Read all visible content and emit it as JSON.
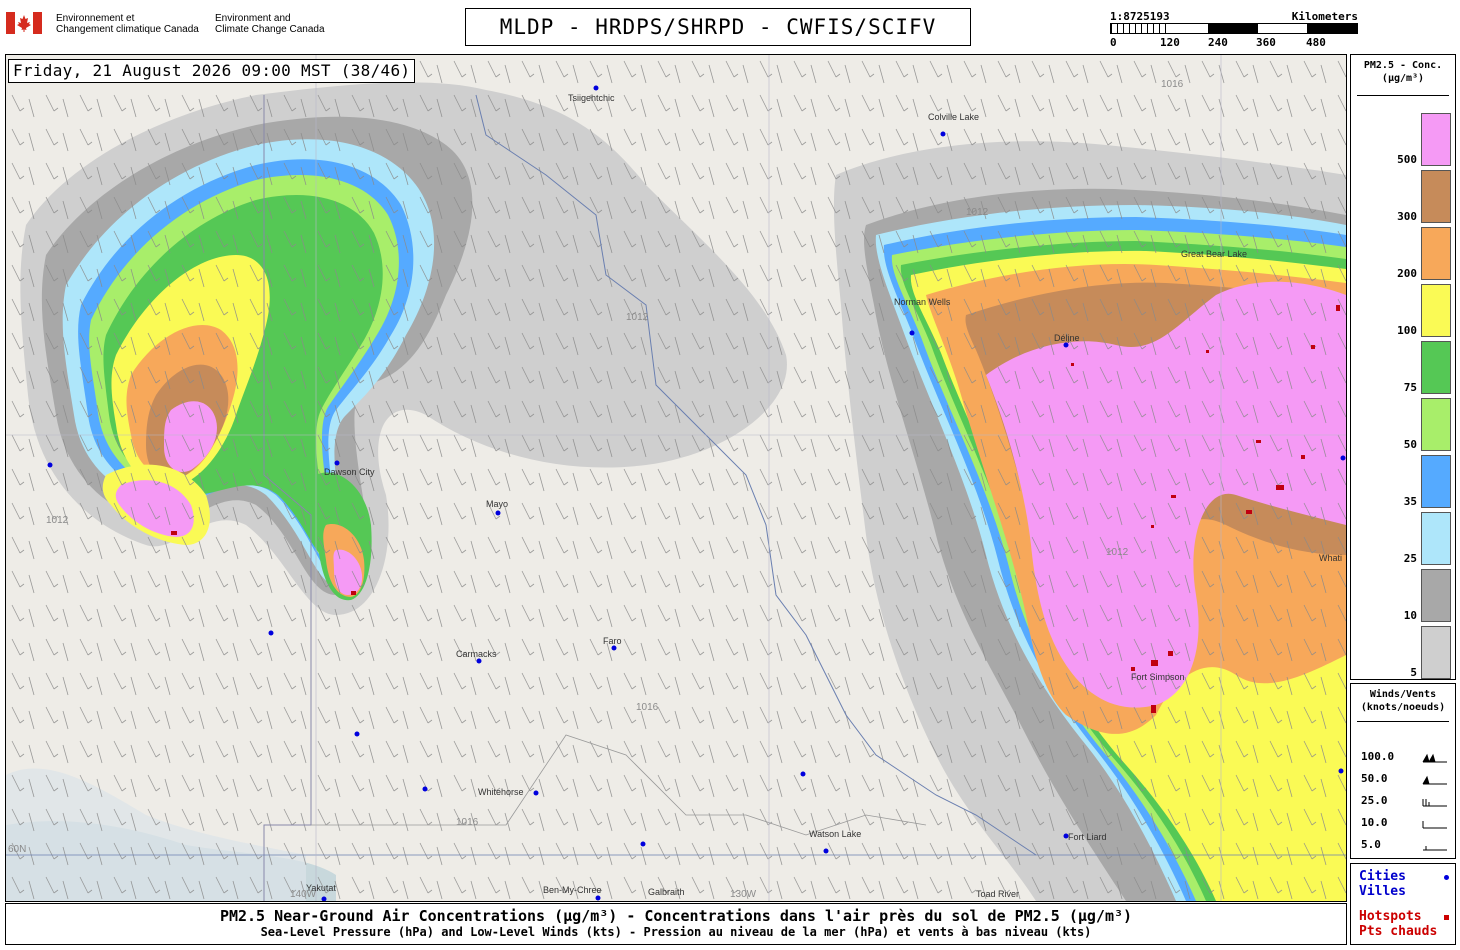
{
  "header": {
    "agency_fr_1": "Environnement et",
    "agency_fr_2": "Changement climatique Canada",
    "agency_en_1": "Environment and",
    "agency_en_2": "Climate Change Canada",
    "title": "MLDP - HRDPS/SHRPD - CWFIS/SCIFV"
  },
  "scale": {
    "ratio": "1:8725193",
    "units": "Kilometers",
    "ticks": [
      "0",
      "120",
      "240",
      "360",
      "480"
    ]
  },
  "map": {
    "timestamp": "Friday, 21 August 2026 09:00 MST (38/46)",
    "cities": [
      {
        "name": "Tsiigehtchic",
        "show_label": true
      },
      {
        "name": "Colville Lake",
        "show_label": true
      },
      {
        "name": "Norman Wells",
        "show_label": true
      },
      {
        "name": "Délįne",
        "show_label": true
      },
      {
        "name": "Great Bear Lake",
        "show_label": true
      },
      {
        "name": "Dawson City",
        "show_label": true
      },
      {
        "name": "Mayo",
        "show_label": true
      },
      {
        "name": "Carmacks",
        "show_label": true
      },
      {
        "name": "Faro",
        "show_label": true
      },
      {
        "name": "Whitehorse",
        "show_label": true
      },
      {
        "name": "Watson Lake",
        "show_label": true
      },
      {
        "name": "Fort Liard",
        "show_label": true
      },
      {
        "name": "Fort Simpson",
        "show_label": true
      },
      {
        "name": "Whati",
        "show_label": true
      },
      {
        "name": "Yakutat",
        "show_label": true
      },
      {
        "name": "Ben-My-Chree",
        "show_label": true
      },
      {
        "name": "Galbraith",
        "show_label": true
      },
      {
        "name": "Toad River",
        "show_label": true
      }
    ],
    "isobar_labels": [
      "1012",
      "1016"
    ],
    "graticule_labels": [
      "60N",
      "140W",
      "130W"
    ],
    "hotspot_color": "#c00010",
    "city_color": "#0000dd"
  },
  "legend": {
    "title_1": "PM2.5 - Conc.",
    "title_2": "(µg/m³)",
    "levels": [
      {
        "label": "500",
        "color": "#f59af5"
      },
      {
        "label": "300",
        "color": "#c68b5a"
      },
      {
        "label": "200",
        "color": "#f7a85a"
      },
      {
        "label": "100",
        "color": "#fafa55"
      },
      {
        "label": "75",
        "color": "#55c855"
      },
      {
        "label": "50",
        "color": "#a8ee6a"
      },
      {
        "label": "35",
        "color": "#55aaff"
      },
      {
        "label": "25",
        "color": "#aee6fa"
      },
      {
        "label": "10",
        "color": "#a8a8a8"
      },
      {
        "label": "5",
        "color": "#cfcfcf"
      }
    ]
  },
  "winds": {
    "title_1": "Winds/Vents",
    "title_2": "(knots/noeuds)",
    "speeds": [
      "100.0",
      "50.0",
      "25.0",
      "10.0",
      "5.0"
    ]
  },
  "cities_legend": {
    "cities_en": "Cities",
    "cities_fr": "Villes",
    "hotspots_en": "Hotspots",
    "hotspots_fr": "Pts chauds"
  },
  "caption": {
    "line1": "PM2.5 Near-Ground Air Concentrations (µg/m³) - Concentrations dans l'air près du sol de PM2.5 (µg/m³)",
    "line2": "Sea-Level Pressure (hPa) and Low-Level Winds (kts) - Pression au niveau de la mer (hPa) et vents à bas niveau (kts)"
  }
}
